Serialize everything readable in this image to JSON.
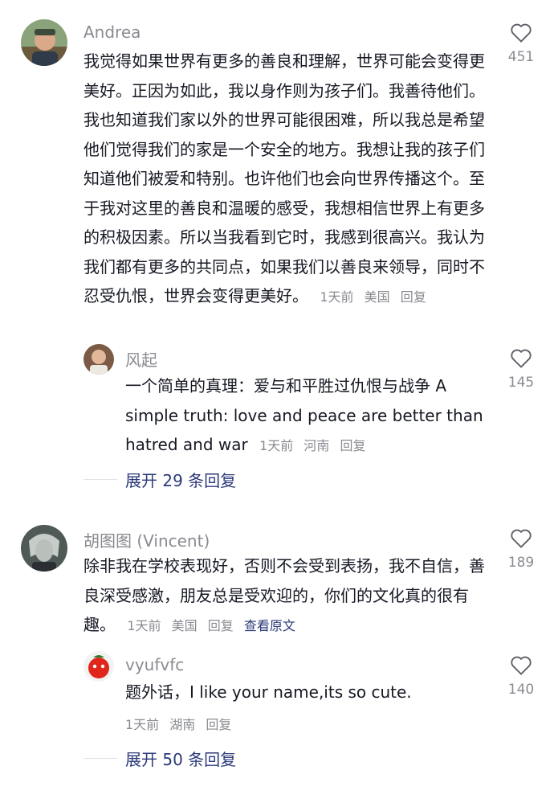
{
  "comments": [
    {
      "username": "Andrea",
      "text": "我觉得如果世界有更多的善良和理解，世界可能会变得更美好。正因为如此，我以身作则为孩子们。我善待他们。我也知道我们家以外的世界可能很困难，所以我总是希望他们觉得我们的家是一个安全的地方。我想让我的孩子们知道他们被爱和特别。也许他们也会向世界传播这个。至于我对这里的善良和温暖的感受，我想相信世界上有更多的积极因素。所以当我看到它时，我感到很高兴。我认为我们都有更多的共同点，如果我们以善良来领导，同时不忍受仇恨，世界会变得更美好。",
      "time": "1天前",
      "location": "美国",
      "reply": "回复",
      "likes": "451"
    },
    {
      "username": "风起",
      "text": "一个简单的真理：爱与和平胜过仇恨与战争 A simple truth: love and peace are better than hatred and war",
      "time": "1天前",
      "location": "河南",
      "reply": "回复",
      "likes": "145",
      "expand": "展开 29 条回复"
    },
    {
      "username": "胡图图 (Vincent)",
      "text": "除非我在学校表现好，否则不会受到表扬，我不自信，善良深受感激，朋友总是受欢迎的，你们的文化真的很有趣。",
      "time": "1天前",
      "location": "美国",
      "reply": "回复",
      "translate": "查看原文",
      "likes": "189"
    },
    {
      "username": "vyufvfc",
      "text": "题外话，I like your name,its so cute.",
      "time": "1天前",
      "location": "湖南",
      "reply": "回复",
      "likes": "140",
      "expand": "展开 50 条回复"
    }
  ],
  "icons": {
    "like": "heart-outline-icon"
  },
  "colors": {
    "text": "#161823",
    "meta": "#8a8b91",
    "link": "#2b3a78",
    "divider": "#e3e3e4"
  }
}
